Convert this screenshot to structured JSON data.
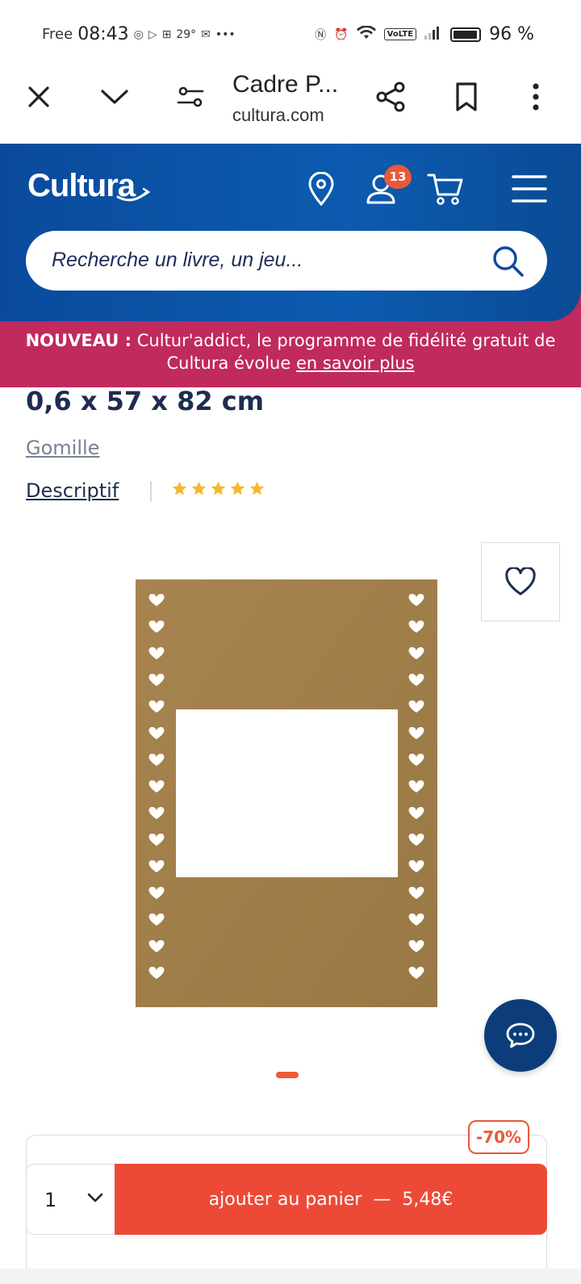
{
  "status_bar": {
    "carrier": "Free",
    "time": "08:43",
    "temperature": "29°",
    "more": "•••",
    "network": "VoLTE",
    "battery": "96 %",
    "battery_level": 0.96
  },
  "browser": {
    "page_title": "Cadre P...",
    "url": "cultura.com"
  },
  "header": {
    "logo_text": "Cultura",
    "notification_count": "13",
    "search_placeholder": "Recherche un livre, un jeu..."
  },
  "promo": {
    "bold_prefix": "NOUVEAU :",
    "text": " Cultur'addict, le programme de fidélité gratuit de Cultura évolue ",
    "link": "en savoir plus"
  },
  "product": {
    "dimensions": "0,6 x 57 x 82 cm",
    "brand": "Gomille",
    "description_link": "Descriptif",
    "rating": 5
  },
  "purchase": {
    "discount": "-70%",
    "quantity": "1",
    "add_to_cart_label": "ajouter au panier",
    "separator": "—",
    "price": "5,48€"
  },
  "colors": {
    "brand_blue": "#0c5bb0",
    "promo_pink": "#c02a5d",
    "accent_orange": "#ec4a36",
    "navy_text": "#1e2d4f",
    "star_yellow": "#f5b82e",
    "kraft": "#a07e4a"
  },
  "icons": [
    "close-icon",
    "chevron-down-icon",
    "settings-sliders-icon",
    "share-icon",
    "bookmark-icon",
    "more-vertical-icon",
    "location-pin-icon",
    "user-icon",
    "cart-icon",
    "menu-icon",
    "search-icon",
    "heart-icon",
    "star-icon",
    "chat-icon"
  ]
}
